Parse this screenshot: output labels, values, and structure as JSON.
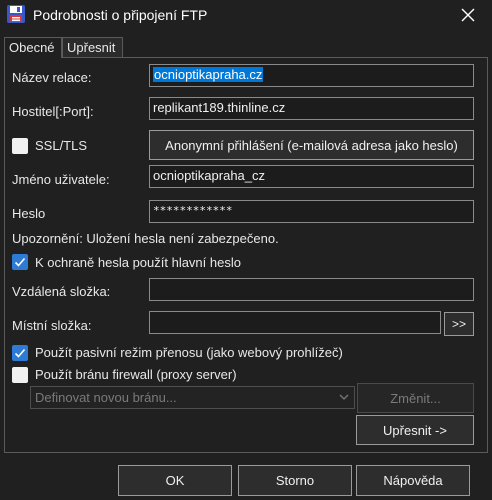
{
  "window": {
    "title": "Podrobnosti o připojení FTP",
    "icon": "floppy-disk-icon"
  },
  "tabs": [
    {
      "label": "Obecné"
    },
    {
      "label": "Upřesnit"
    }
  ],
  "form": {
    "session_name": {
      "label": "Název relace:",
      "value": "ocnioptikapraha.cz"
    },
    "host": {
      "label": "Hostitel[:Port]:",
      "value": "replikant189.thinline.cz"
    },
    "ssl": {
      "label": "SSL/TLS",
      "checked": false
    },
    "anonymous_button": "Anonymní přihlášení (e-mailová adresa jako heslo)",
    "username": {
      "label": "Jméno uživatele:",
      "value": "ocnioptikapraha_cz"
    },
    "password": {
      "label": "Heslo",
      "value": "************"
    },
    "warning": "Upozornění: Uložení hesla není zabezpečeno.",
    "master_password": {
      "label": "K ochraně hesla použít hlavní heslo",
      "checked": true
    },
    "remote_folder": {
      "label": "Vzdálená složka:",
      "value": ""
    },
    "local_folder": {
      "label": "Místní složka:",
      "value": "",
      "browse": ">>"
    },
    "passive": {
      "label": "Použít pasivní režim přenosu (jako webový prohlížeč)",
      "checked": true
    },
    "firewall": {
      "label": "Použít bránu firewall (proxy server)",
      "checked": false
    },
    "gateway_select": "Definovat novou bránu...",
    "change_button": "Změnit...",
    "advanced_button": "Upřesnit ->"
  },
  "footer": {
    "ok": "OK",
    "cancel": "Storno",
    "help": "Nápověda"
  },
  "colors": {
    "accent": "#2e7bd6",
    "selection": "#0078d7",
    "background": "#202020"
  }
}
